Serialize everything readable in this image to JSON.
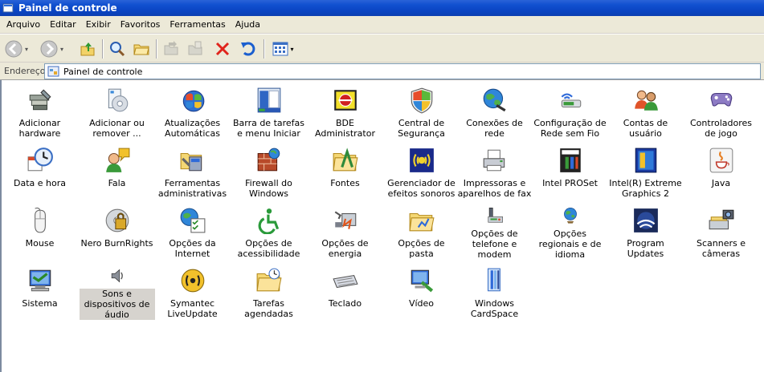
{
  "window": {
    "title": "Painel de controle"
  },
  "menu": [
    "Arquivo",
    "Editar",
    "Exibir",
    "Favoritos",
    "Ferramentas",
    "Ajuda"
  ],
  "address": {
    "label": "Endereço",
    "value": "Painel de controle"
  },
  "items": [
    {
      "label": "Adicionar hardware",
      "icon": "add-hardware-icon"
    },
    {
      "label": "Adicionar ou remover ...",
      "icon": "add-remove-programs-icon"
    },
    {
      "label": "Atualizações Automáticas",
      "icon": "automatic-updates-icon"
    },
    {
      "label": "Barra de tarefas e menu Iniciar",
      "icon": "taskbar-start-menu-icon"
    },
    {
      "label": "BDE Administrator",
      "icon": "bde-administrator-icon"
    },
    {
      "label": "Central de Segurança",
      "icon": "security-center-shield-icon"
    },
    {
      "label": "Conexões de rede",
      "icon": "network-connections-icon"
    },
    {
      "label": "Configuração de Rede sem Fio",
      "icon": "wireless-network-icon"
    },
    {
      "label": "Contas de usuário",
      "icon": "user-accounts-icon"
    },
    {
      "label": "Controladores de jogo",
      "icon": "game-controller-icon"
    },
    {
      "label": "Data e hora",
      "icon": "date-time-icon"
    },
    {
      "label": "Fala",
      "icon": "speech-icon"
    },
    {
      "label": "Ferramentas administrativas",
      "icon": "admin-tools-icon"
    },
    {
      "label": "Firewall do Windows",
      "icon": "firewall-icon"
    },
    {
      "label": "Fontes",
      "icon": "fonts-folder-icon"
    },
    {
      "label": "Gerenciador de efeitos sonoros",
      "icon": "sound-effects-icon"
    },
    {
      "label": "Impressoras e aparelhos de fax",
      "icon": "printer-icon"
    },
    {
      "label": "Intel PROSet",
      "icon": "intel-proset-icon"
    },
    {
      "label": "Intel(R) Extreme Graphics 2",
      "icon": "intel-graphics-icon"
    },
    {
      "label": "Java",
      "icon": "java-icon"
    },
    {
      "label": "Mouse",
      "icon": "mouse-icon"
    },
    {
      "label": "Nero BurnRights",
      "icon": "nero-burnrights-icon"
    },
    {
      "label": "Opções da Internet",
      "icon": "internet-options-icon"
    },
    {
      "label": "Opções de acessibilidade",
      "icon": "accessibility-icon"
    },
    {
      "label": "Opções de energia",
      "icon": "power-options-icon"
    },
    {
      "label": "Opções de pasta",
      "icon": "folder-options-icon"
    },
    {
      "label": "Opções de telefone e modem",
      "icon": "phone-modem-icon"
    },
    {
      "label": "Opções regionais e de idioma",
      "icon": "regional-language-icon"
    },
    {
      "label": "Program Updates",
      "icon": "program-updates-icon"
    },
    {
      "label": "Scanners e câmeras",
      "icon": "scanner-camera-icon"
    },
    {
      "label": "Sistema",
      "icon": "system-icon"
    },
    {
      "label": "Sons e dispositivos de áudio",
      "icon": "sound-devices-icon",
      "selected": true
    },
    {
      "label": "Symantec LiveUpdate",
      "icon": "symantec-liveupdate-icon"
    },
    {
      "label": "Tarefas agendadas",
      "icon": "scheduled-tasks-icon"
    },
    {
      "label": "Teclado",
      "icon": "keyboard-icon"
    },
    {
      "label": "Vídeo",
      "icon": "video-icon"
    },
    {
      "label": "Windows CardSpace",
      "icon": "cardspace-icon"
    }
  ]
}
